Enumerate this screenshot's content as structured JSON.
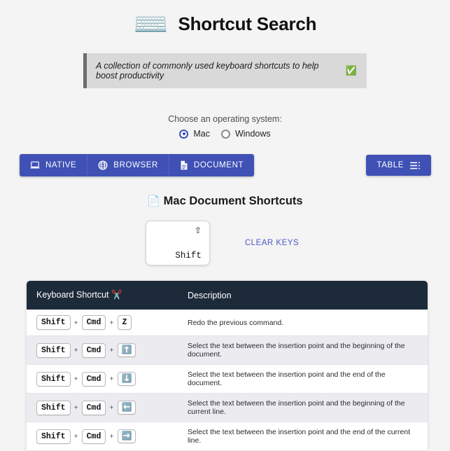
{
  "header": {
    "icon": "keyboard-emoji",
    "icon_glyph": "⌨️",
    "title": "Shortcut Search"
  },
  "banner": {
    "text": "A collection of commonly used keyboard shortcuts to help boost productivity",
    "check_glyph": "✅"
  },
  "os_chooser": {
    "label": "Choose an operating system:",
    "options": [
      {
        "label": "Mac",
        "selected": true
      },
      {
        "label": "Windows",
        "selected": false
      }
    ]
  },
  "toolbar": {
    "segments": [
      {
        "label": "NATIVE",
        "icon": "laptop-icon"
      },
      {
        "label": "BROWSER",
        "icon": "globe-icon"
      },
      {
        "label": "DOCUMENT",
        "icon": "document-icon"
      }
    ],
    "table_button": {
      "label": "TABLE",
      "icon": "table-list-icon"
    }
  },
  "section": {
    "emoji": "📄",
    "title": "Mac Document Shortcuts"
  },
  "keys": {
    "selected": [
      {
        "symbol": "⇧",
        "name": "Shift"
      }
    ],
    "clear_label": "CLEAR KEYS"
  },
  "table": {
    "columns": {
      "shortcut": "Keyboard Shortcut",
      "shortcut_emoji": "✂️",
      "description": "Description"
    },
    "rows": [
      {
        "keys": [
          {
            "text": "Shift",
            "emoji": false
          },
          {
            "text": "Cmd",
            "emoji": false
          },
          {
            "text": "Z",
            "emoji": false
          }
        ],
        "description": "Redo the previous command."
      },
      {
        "keys": [
          {
            "text": "Shift",
            "emoji": false
          },
          {
            "text": "Cmd",
            "emoji": false
          },
          {
            "text": "⬆️",
            "emoji": true
          }
        ],
        "description": "Select the text between the insertion point and the beginning of the document."
      },
      {
        "keys": [
          {
            "text": "Shift",
            "emoji": false
          },
          {
            "text": "Cmd",
            "emoji": false
          },
          {
            "text": "⬇️",
            "emoji": true
          }
        ],
        "description": "Select the text between the insertion point and the end of the document."
      },
      {
        "keys": [
          {
            "text": "Shift",
            "emoji": false
          },
          {
            "text": "Cmd",
            "emoji": false
          },
          {
            "text": "⬅️",
            "emoji": true
          }
        ],
        "description": "Select the text between the insertion point and the beginning of the current line."
      },
      {
        "keys": [
          {
            "text": "Shift",
            "emoji": false
          },
          {
            "text": "Cmd",
            "emoji": false
          },
          {
            "text": "➡️",
            "emoji": true
          }
        ],
        "description": "Select the text between the insertion point and the end of the current line."
      }
    ],
    "plus_separator": "+"
  },
  "colors": {
    "accent": "#3f51b5",
    "header_dark": "#1d2a3a",
    "link": "#4a58c4",
    "page_bg": "#f4f4f4",
    "banner_bg": "#d9d9d9"
  }
}
